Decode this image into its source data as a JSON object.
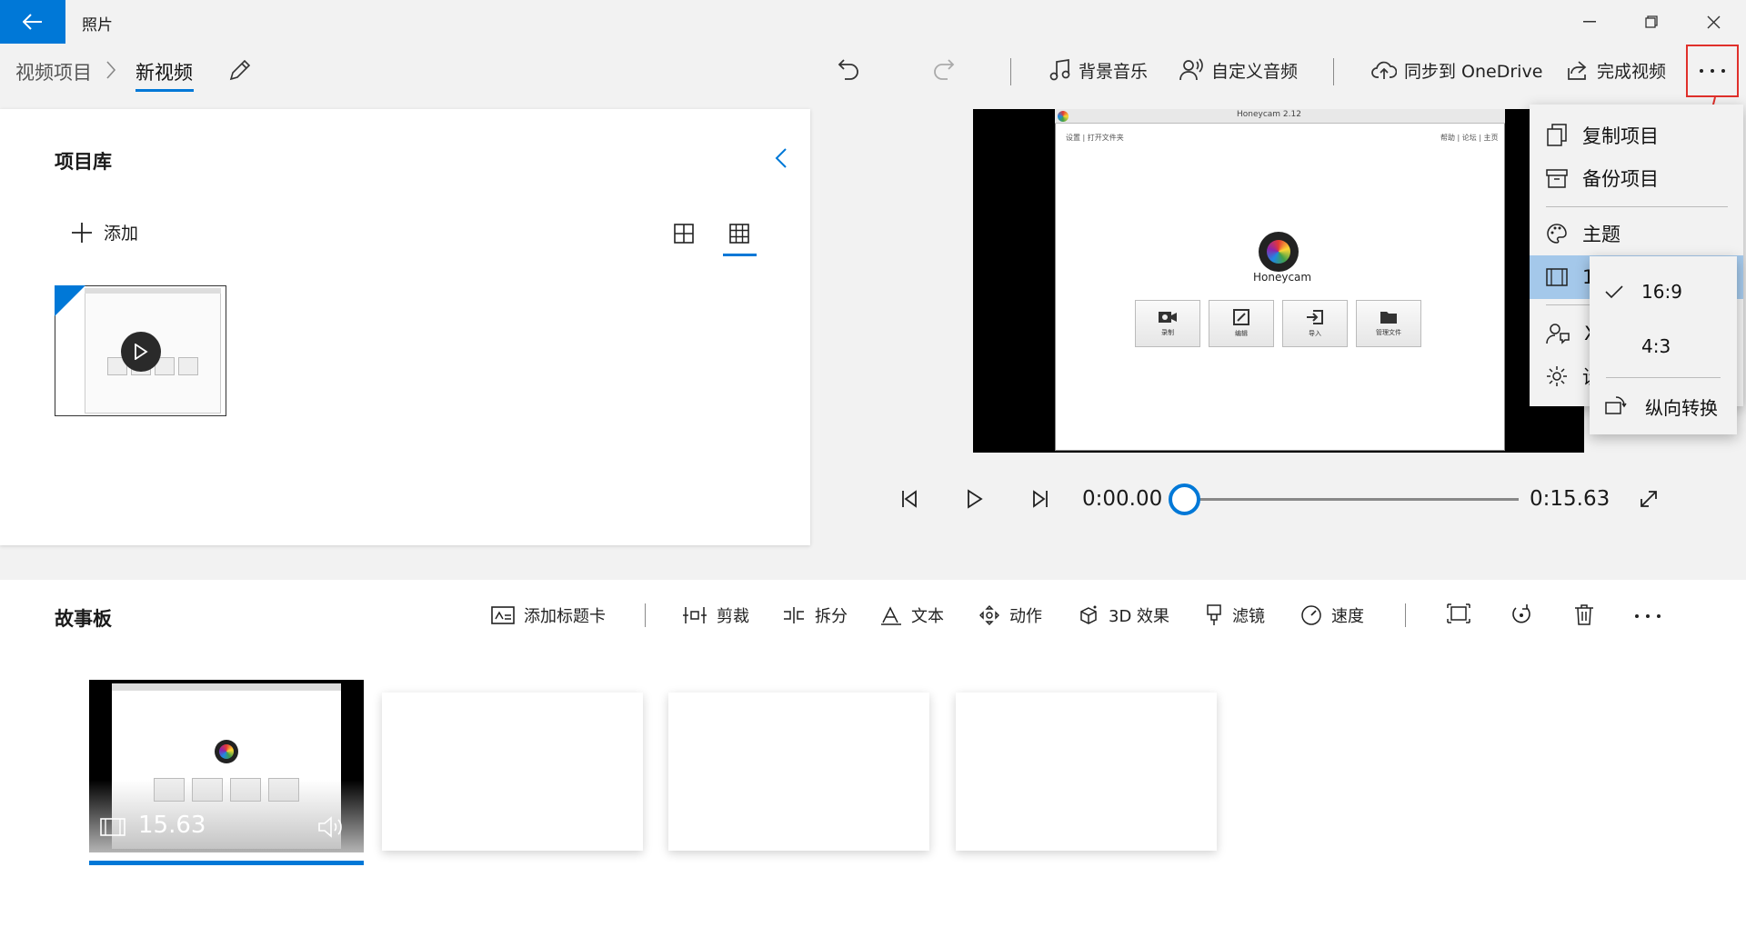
{
  "app": {
    "title": "照片"
  },
  "breadcrumb": {
    "parent": "视频项目",
    "current": "新视频"
  },
  "toolbar": {
    "background_music": "背景音乐",
    "custom_audio": "自定义音频",
    "sync_onedrive": "同步到 OneDrive",
    "finish_video": "完成视频"
  },
  "library": {
    "title": "项目库",
    "add_label": "添加"
  },
  "preview": {
    "window_title": "Honeycam 2.12",
    "menu_text": "设置 | 打开文件夹",
    "right_links": "帮助 | 论坛 | 主页",
    "app_name": "Honeycam",
    "buttons": [
      "录制",
      "编辑",
      "导入",
      "管理文件"
    ]
  },
  "playback": {
    "current_time": "0:00.00",
    "total_time": "0:15.63",
    "progress": 0
  },
  "storyboard": {
    "title": "故事板",
    "tools": {
      "title_card": "添加标题卡",
      "trim": "剪裁",
      "split": "拆分",
      "text": "文本",
      "motion": "动作",
      "effects_3d": "3D 效果",
      "filters": "滤镜",
      "speed": "速度"
    },
    "clip": {
      "duration": "15.63"
    }
  },
  "more_menu": {
    "items": [
      "复制项目",
      "备份项目",
      "主题",
      "1",
      "X",
      "设"
    ],
    "aspect_submenu": {
      "options": [
        "16:9",
        "4:3"
      ],
      "selected": "16:9",
      "portrait": "纵向转换"
    }
  },
  "colors": {
    "accent": "#0078d7",
    "highlight": "#e0302b"
  }
}
